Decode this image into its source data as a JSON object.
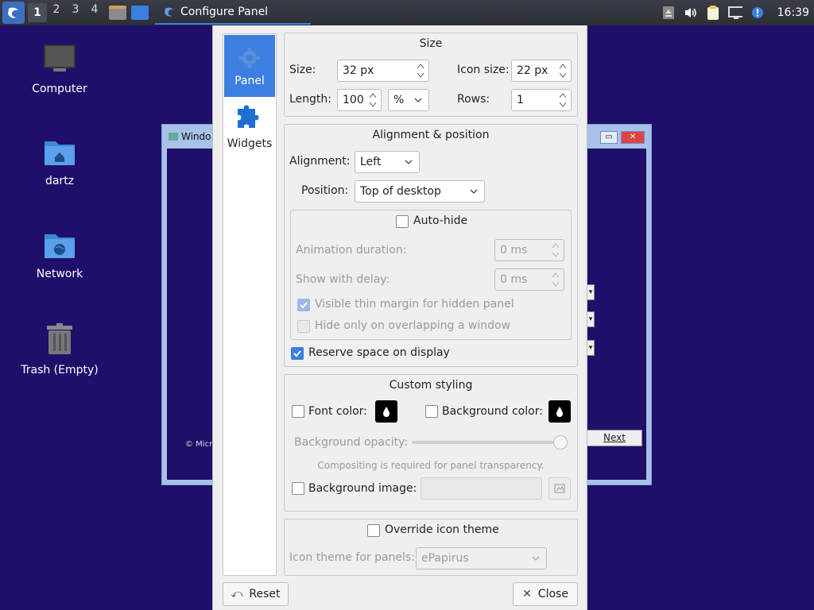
{
  "taskbar": {
    "desktops": [
      "1",
      "2",
      "3",
      "4"
    ],
    "active_desktop": "1",
    "task_title": "Configure Panel",
    "clock": "16:39"
  },
  "desktop_icons": [
    {
      "label": "Computer",
      "icon": "computer-icon"
    },
    {
      "label": "dartz",
      "icon": "home-folder-icon"
    },
    {
      "label": "Network",
      "icon": "network-folder-icon"
    },
    {
      "label": "Trash (Empty)",
      "icon": "trash-icon"
    }
  ],
  "bg_window": {
    "title": "Windo",
    "copyright": "© Micr",
    "next_label": "Next"
  },
  "dialog": {
    "sidebar": [
      {
        "label": "Panel",
        "icon": "gear-icon",
        "active": true
      },
      {
        "label": "Widgets",
        "icon": "puzzle-icon",
        "active": false
      }
    ],
    "size": {
      "title": "Size",
      "size_label": "Size:",
      "size_value": "32 px",
      "icon_size_label": "Icon size:",
      "icon_size_value": "22 px",
      "length_label": "Length:",
      "length_value": "100",
      "length_unit": "%",
      "rows_label": "Rows:",
      "rows_value": "1"
    },
    "alignment": {
      "title": "Alignment & position",
      "alignment_label": "Alignment:",
      "alignment_value": "Left",
      "position_label": "Position:",
      "position_value": "Top of desktop",
      "autohide_label": "Auto-hide",
      "autohide_checked": false,
      "anim_label": "Animation duration:",
      "anim_value": "0 ms",
      "delay_label": "Show with delay:",
      "delay_value": "0 ms",
      "thin_margin_label": "Visible thin margin for hidden panel",
      "thin_margin_checked": true,
      "overlap_label": "Hide only on overlapping a window",
      "overlap_checked": false,
      "reserve_label": "Reserve space on display",
      "reserve_checked": true
    },
    "styling": {
      "title": "Custom styling",
      "font_color_label": "Font color:",
      "bg_color_label": "Background color:",
      "opacity_label": "Background opacity:",
      "opacity_level": 1.0,
      "compositing_note": "Compositing is required for panel transparency.",
      "bg_image_label": "Background image:"
    },
    "icon_theme": {
      "override_label": "Override icon theme",
      "theme_label": "Icon theme for panels:",
      "theme_value": "ePapirus"
    },
    "buttons": {
      "reset": "Reset",
      "close": "Close"
    }
  }
}
